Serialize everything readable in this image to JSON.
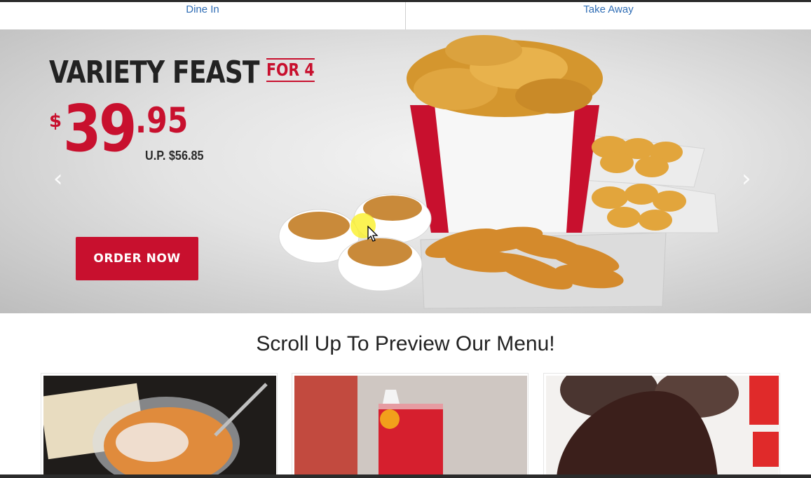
{
  "tabs": [
    {
      "label": "Dine In"
    },
    {
      "label": "Take Away"
    }
  ],
  "hero": {
    "title": "VARIETY FEAST",
    "title_suffix": "FOR 4",
    "price_symbol": "$",
    "price_dollars": "39",
    "price_cents": ".95",
    "usual_price": "U.P. $56.85",
    "cta_label": "ORDER NOW",
    "prev_arrow": "‹",
    "next_arrow": "›"
  },
  "menu": {
    "heading": "Scroll Up To Preview Our Menu!",
    "cards": [
      {
        "name": "punch-bowl"
      },
      {
        "name": "red-drink"
      },
      {
        "name": "chocolate-cake"
      }
    ]
  },
  "colors": {
    "brand_red": "#c8102e",
    "link_blue": "#2f6db5"
  }
}
